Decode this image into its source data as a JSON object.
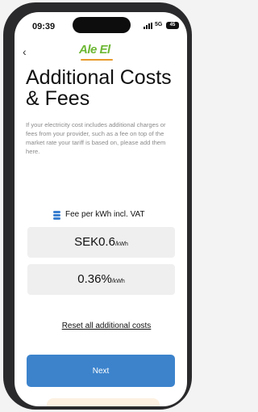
{
  "status_bar": {
    "time": "09:39",
    "network": "5G",
    "battery": "45"
  },
  "header": {
    "back_icon": "chevron-left-icon",
    "logo_text": "Ale El"
  },
  "page": {
    "title": "Additional Costs & Fees",
    "description": "If your electricity cost includes additional charges or fees from your provider, such as a fee on top of the market rate your tariff is based on, please add them here."
  },
  "fee_label": "Fee per kWh incl. VAT",
  "fields": {
    "fee_per_kwh": {
      "value": "SEK0.6",
      "unit": "/kWh"
    },
    "percent_fee": {
      "value": "0.36%",
      "unit": "/kWh"
    }
  },
  "reset_label": "Reset all additional costs",
  "next_label": "Next",
  "colors": {
    "primary": "#3c83cc",
    "logo_green": "#6cb733",
    "logo_orange": "#e89a2a",
    "field_bg": "#efefef"
  }
}
